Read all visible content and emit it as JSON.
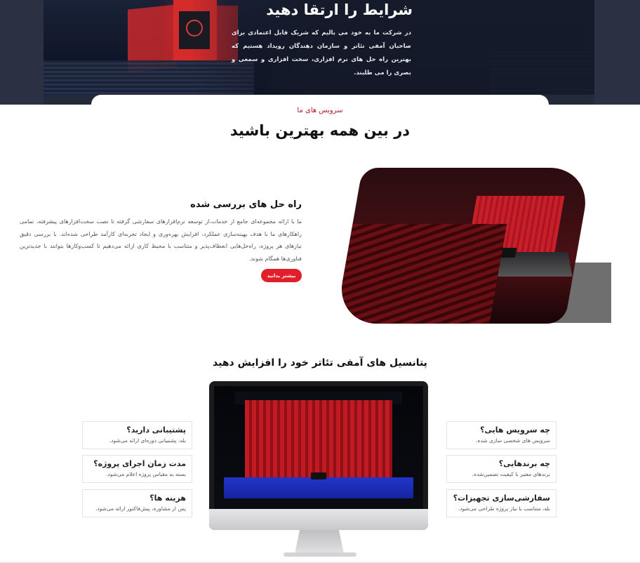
{
  "hero": {
    "title": "شرایط را ارتقا دهید",
    "text": "در شرکت ما به خود می بالیم که شریک قابل اعتمادی برای صاحبان آمفی تئاتر و سازمان دهندگان رویداد هستیم که بهترین راه حل های نرم افزاری، سخت افزاری و سمعی و بصری را می طلبند."
  },
  "services": {
    "kicker": "سرویس های ما",
    "title": "در بین همه بهترین باشید"
  },
  "feature": {
    "heading": "راه حل های بررسی شده",
    "text": "ما با ارائه مجموعه‌ای جامع از خدمات،از توسعه نرم‌افزارهای سفارشی گرفته تا نصب سخت‌افزارهای پیشرفته، تمامی راهکارهای ما با هدف بهینه‌سازی عملکرد، افزایش بهره‌وری و ایجاد تجربه‌ای کارآمد طراحی شده‌اند. با بررسی دقیق نیازهای هر پروژه، راه‌حل‌هایی انعطاف‌پذیر و متناسب با محیط کاری ارائه می‌دهیم تا کسب‌وکارها بتوانند با جدیدترین فناوری‌ها همگام شوند.",
    "button_label": "بیشتر بدانید"
  },
  "potential": {
    "title": "پتانسیل های آمفی تئاتر خود را افزایش دهید"
  },
  "faq_right": [
    {
      "q": "چه سرویس هایی؟",
      "a": "سرویس های شخصی سازی شده."
    },
    {
      "q": "چه برندهایی؟",
      "a": "برندهای معتبر با کیفیت تضمین‌شده."
    },
    {
      "q": "سفارشی‌سازی تجهیزات؟",
      "a": "بله، متناسب با نیاز پروژه طراحی می‌شود."
    }
  ],
  "faq_left": [
    {
      "q": "پشتیبانی دارید؟",
      "a": "بله، پشتیبانی دوره‌ای ارائه می‌شود."
    },
    {
      "q": "مدت زمان اجرای پروژه؟",
      "a": "بسته به مقیاس پروژه اعلام می‌شود."
    },
    {
      "q": "هزینه ها؟",
      "a": "پس از مشاوره، پیش‌فاکتور ارائه می‌شود."
    }
  ],
  "icons": {
    "apple": "apple-logo-icon"
  },
  "colors": {
    "accent": "#e01f2b",
    "hero_bg": "#232a3a"
  }
}
